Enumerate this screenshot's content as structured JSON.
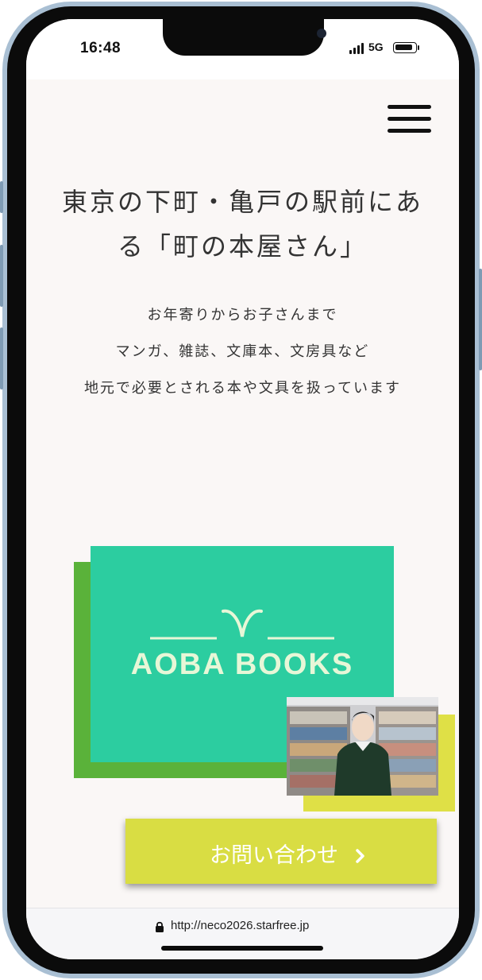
{
  "status_bar": {
    "time": "16:48",
    "network": "5G",
    "icons": [
      "signal-icon",
      "battery-icon"
    ]
  },
  "nav": {
    "menu_icon": "hamburger-menu-icon"
  },
  "hero": {
    "headline_line1": "東京の下町・亀戸の駅前にあ",
    "headline_line2": "る「町の本屋さん」",
    "intro_lines": [
      "お年寄りからお子さんまで",
      "マンガ、雑誌、文庫本、文房具など",
      "地元で必要とされる本や文具を扱っています"
    ]
  },
  "logo": {
    "text": "AOBA BOOKS"
  },
  "cta": {
    "label": "お問い合わせ",
    "icon": "chevron-right-icon"
  },
  "browser": {
    "url": "http://neco2026.starfree.jp",
    "lock_icon": "lock-icon"
  },
  "colors": {
    "background": "#faf7f6",
    "logo_card": "#2ccda0",
    "logo_shadow": "#5ab23a",
    "accent_yellow": "#dfe046",
    "cta": "#d9dd43",
    "logo_text": "#e7f7d7"
  }
}
